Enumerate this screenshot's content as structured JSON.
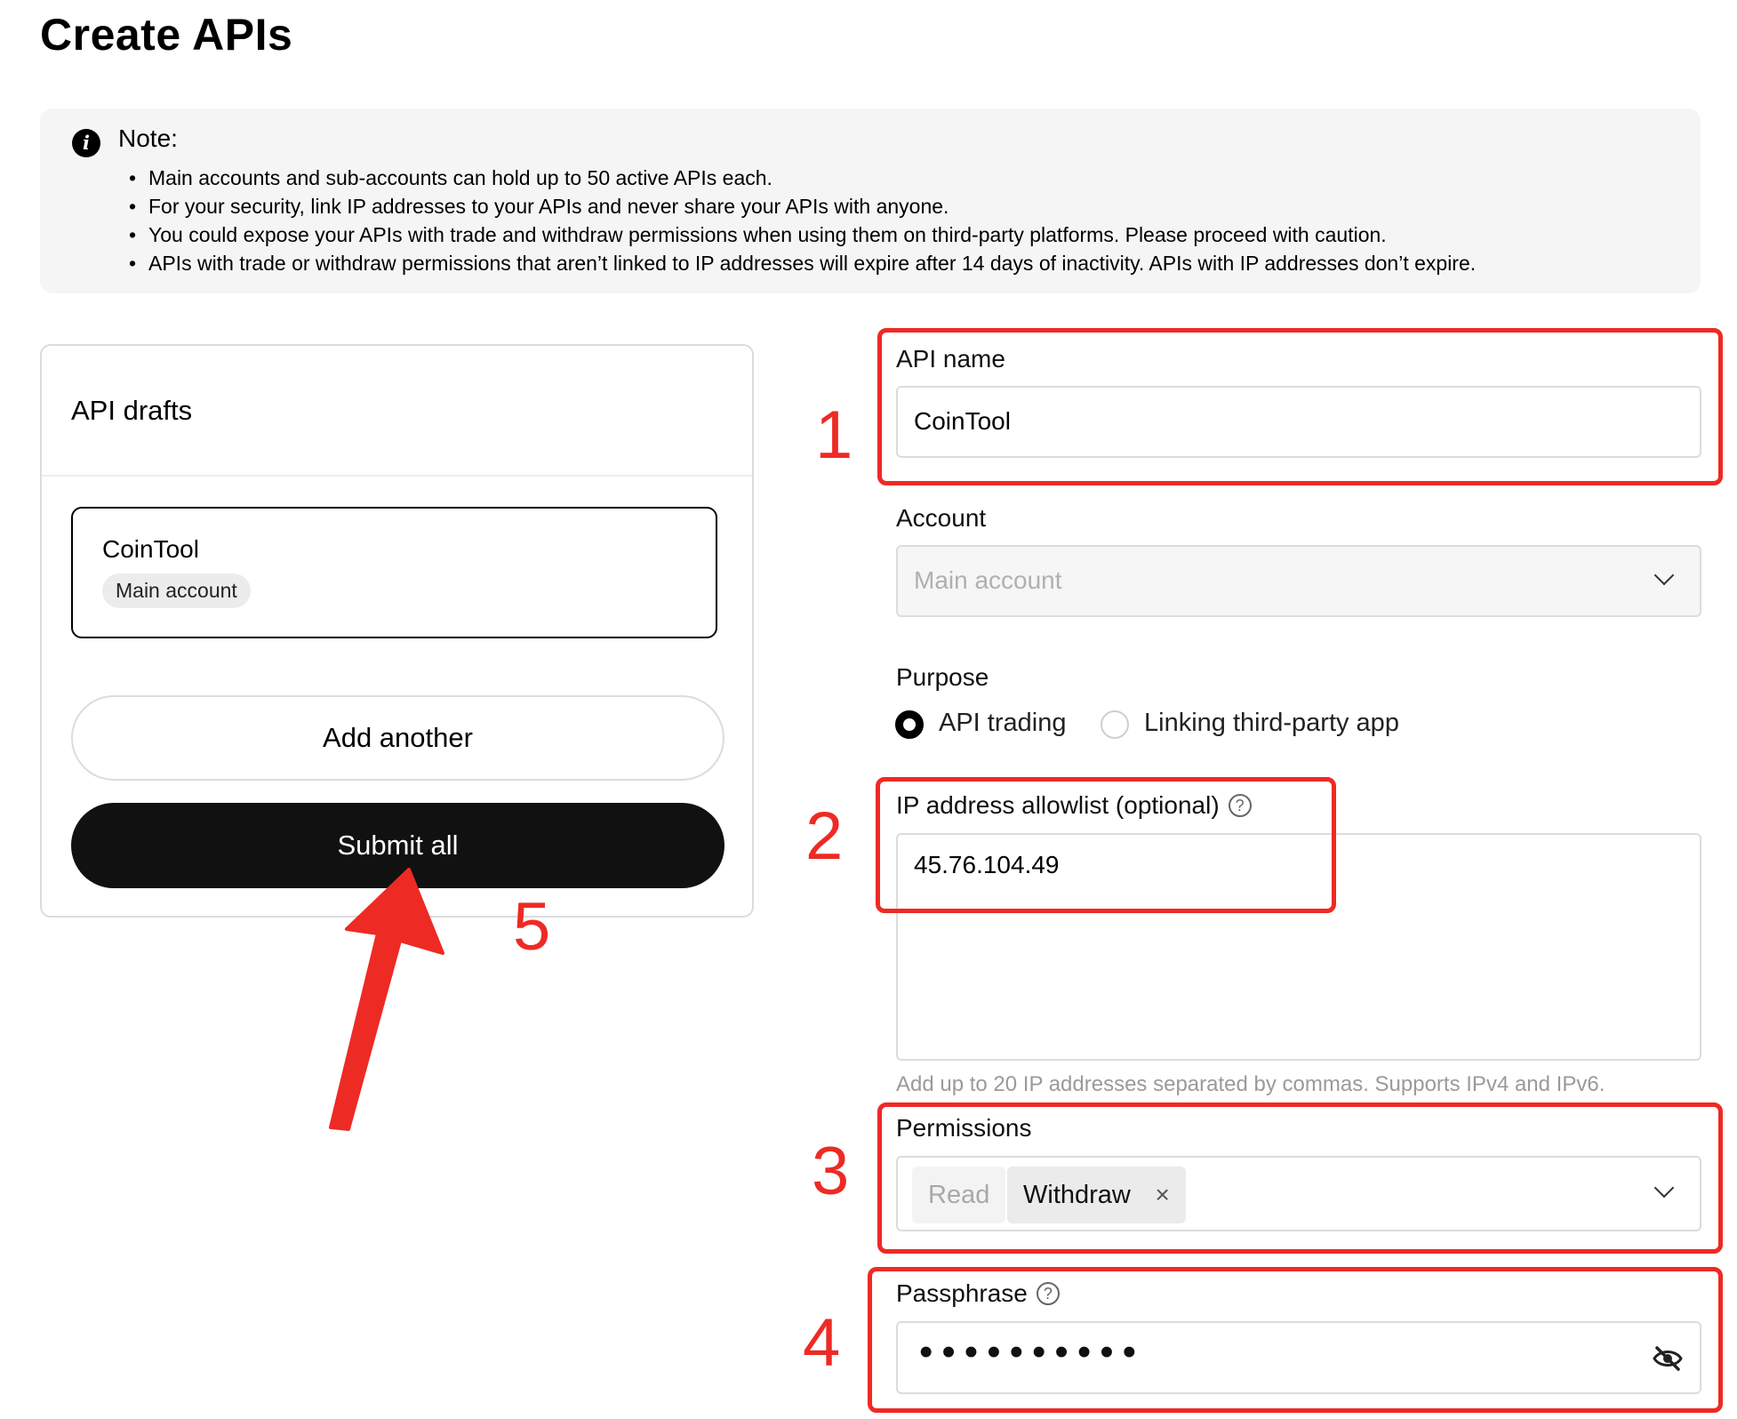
{
  "page": {
    "title": "Create APIs"
  },
  "note": {
    "title": "Note:",
    "items": [
      "Main accounts and sub-accounts can hold up to 50 active APIs each.",
      "For your security, link IP addresses to your APIs and never share your APIs with anyone.",
      "You could expose your APIs with trade and withdraw permissions when using them on third-party platforms. Please proceed with caution.",
      "APIs with trade or withdraw permissions that aren’t linked to IP addresses will expire after 14 days of inactivity. APIs with IP addresses don’t expire."
    ]
  },
  "drafts": {
    "title": "API drafts",
    "card": {
      "name": "CoinTool",
      "tag": "Main account"
    },
    "add_label": "Add another",
    "submit_label": "Submit all"
  },
  "form": {
    "api_name": {
      "label": "API name",
      "value": "CoinTool"
    },
    "account": {
      "label": "Account",
      "value": "Main account"
    },
    "purpose": {
      "label": "Purpose",
      "options": [
        "API trading",
        "Linking third-party app"
      ],
      "selected": "API trading"
    },
    "ip_allowlist": {
      "label": "IP address allowlist (optional)",
      "value": "45.76.104.49",
      "helper": "Add up to 20 IP addresses separated by commas. Supports IPv4 and IPv6."
    },
    "permissions": {
      "label": "Permissions",
      "tags": [
        "Read",
        "Withdraw"
      ],
      "remove_symbol": "×"
    },
    "passphrase": {
      "label": "Passphrase",
      "masked_value": "••••••••••"
    }
  },
  "icons": {
    "note": "info-icon",
    "help": "question-circle-icon",
    "dropdown": "chevron-down-icon",
    "visibility": "eye-off-icon"
  },
  "annotations": {
    "color": "#ee2a24",
    "steps": [
      "1",
      "2",
      "3",
      "4",
      "5"
    ]
  }
}
